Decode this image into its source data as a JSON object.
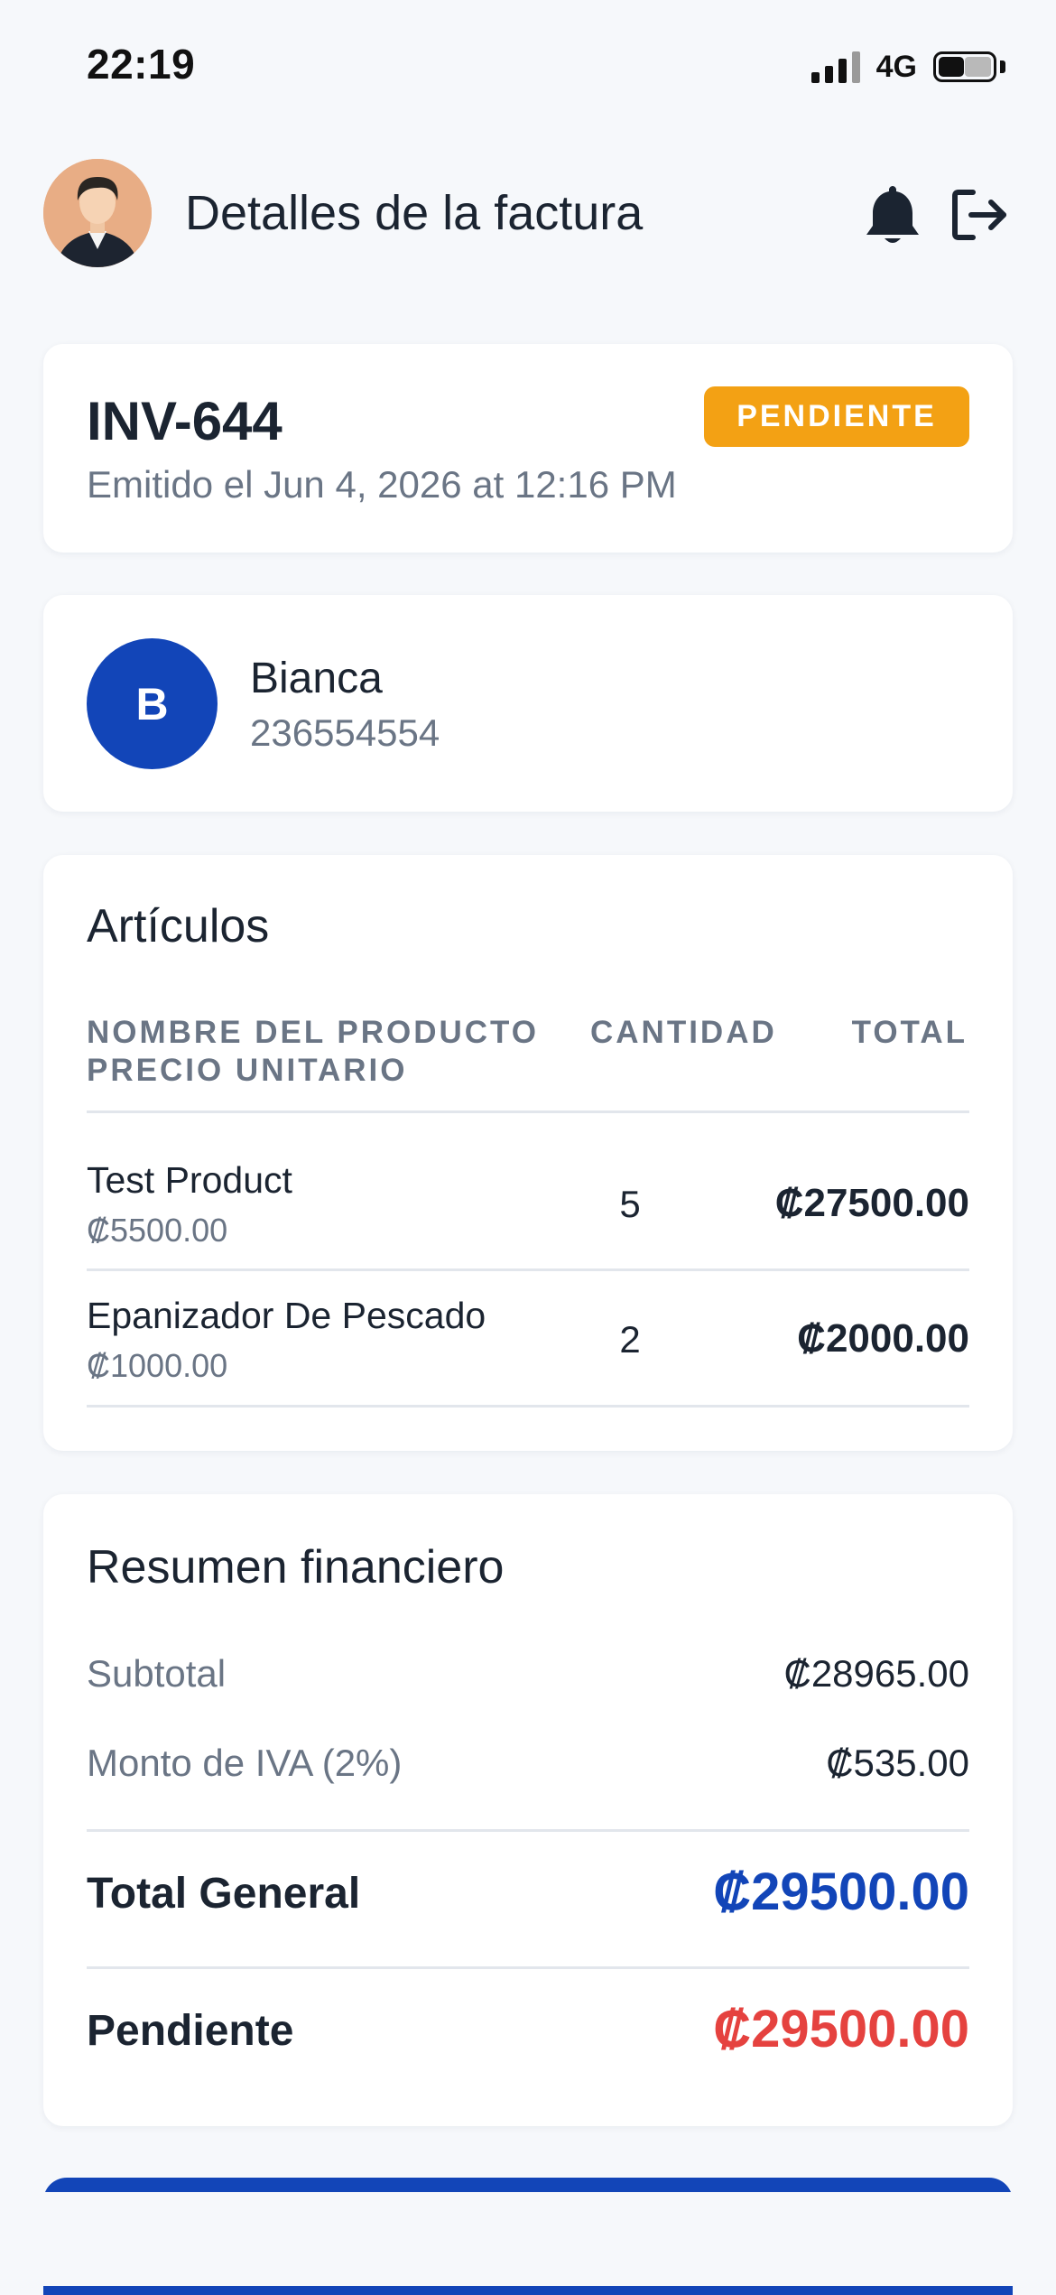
{
  "status_bar": {
    "time": "22:19",
    "network": "4G"
  },
  "header": {
    "title": "Detalles de la factura"
  },
  "invoice": {
    "number": "INV-644",
    "issued": "Emitido el Jun 4, 2026 at 12:16 PM",
    "status": "PENDIENTE"
  },
  "client": {
    "initial": "B",
    "name": "Bianca",
    "phone": "236554554"
  },
  "items": {
    "title": "Artículos",
    "columns": {
      "product": "NOMBRE DEL PRODUCTO",
      "unit_price": "PRECIO UNITARIO",
      "quantity": "CANTIDAD",
      "total": "TOTAL"
    },
    "rows": [
      {
        "name": "Test Product",
        "unit_price": "₡5500.00",
        "quantity": "5",
        "total": "₡27500.00"
      },
      {
        "name": "Epanizador De Pescado",
        "unit_price": "₡1000.00",
        "quantity": "2",
        "total": "₡2000.00"
      }
    ]
  },
  "summary": {
    "title": "Resumen financiero",
    "subtotal_label": "Subtotal",
    "subtotal_value": "₡28965.00",
    "tax_label": "Monto de IVA (2%)",
    "tax_value": "₡535.00",
    "total_label": "Total General",
    "total_value": "₡29500.00",
    "pending_label": "Pendiente",
    "pending_value": "₡29500.00"
  },
  "colors": {
    "accent": "#1245b8",
    "pending_badge": "#f3a114",
    "pending_amount": "#e5423f"
  }
}
